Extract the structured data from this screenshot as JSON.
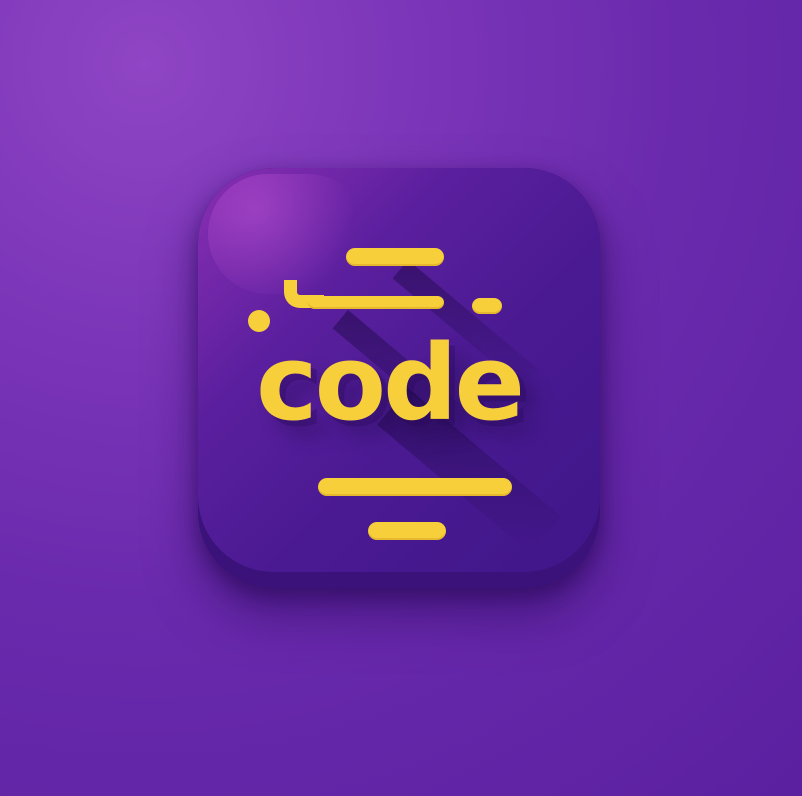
{
  "icon": {
    "word": "code",
    "semantic_icon": "code-app-icon"
  },
  "colors": {
    "background": "#6a2aad",
    "icon_face": "#4a1a92",
    "accent": "#f7cf3b"
  }
}
